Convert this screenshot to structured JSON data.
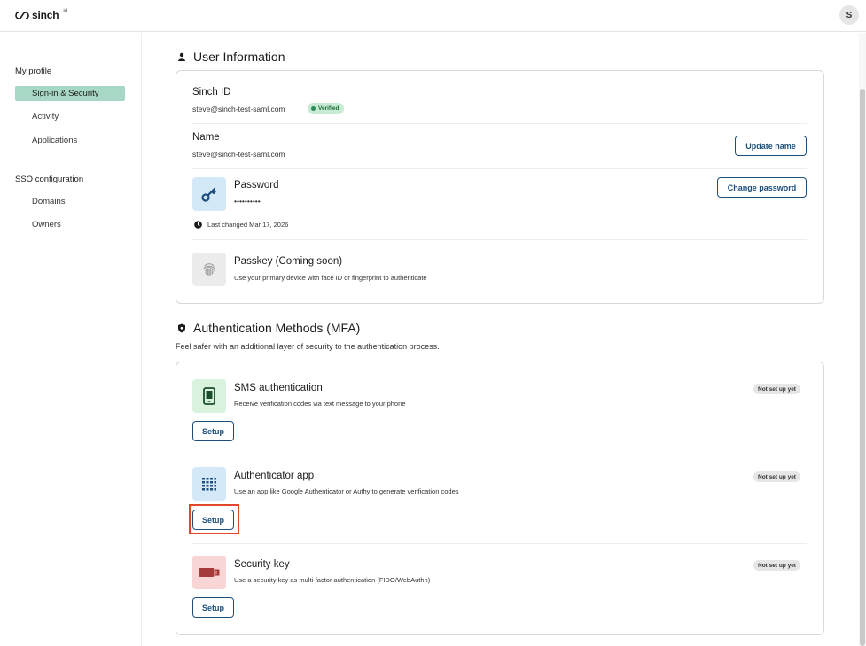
{
  "header": {
    "logo_text": "sinch",
    "logo_sup": "id",
    "avatar_initial": "S"
  },
  "sidebar": {
    "group1_title": "My profile",
    "group1_items": [
      "Sign-in & Security",
      "Activity",
      "Applications"
    ],
    "group2_title": "SSO configuration",
    "group2_items": [
      "Domains",
      "Owners"
    ]
  },
  "user_info": {
    "title": "User Information",
    "sinch_id_label": "Sinch ID",
    "sinch_id_value": "steve@sinch-test-saml.com",
    "verified_badge": "Verified",
    "name_label": "Name",
    "name_value": "steve@sinch-test-saml.com",
    "update_name_button": "Update name",
    "password_label": "Password",
    "password_value": "••••••••••",
    "change_password_button": "Change password",
    "last_changed": "Last changed Mar 17, 2026",
    "passkey_label": "Passkey (Coming soon)",
    "passkey_desc": "Use your primary device with face ID or fingerprint to authenticate"
  },
  "mfa": {
    "title": "Authentication Methods (MFA)",
    "subtitle": "Feel safer with an additional layer of security to the authentication process.",
    "methods": [
      {
        "name": "SMS authentication",
        "desc": "Receive verification codes via text message to your phone",
        "status": "Not set up yet",
        "button": "Setup",
        "icon": "phone-icon"
      },
      {
        "name": "Authenticator app",
        "desc": "Use an app like Google Authenticator or Authy to generate verification codes",
        "status": "Not set up yet",
        "button": "Setup",
        "icon": "grid-icon"
      },
      {
        "name": "Security key",
        "desc": "Use a security key as multi-factor authentication (FIDO/WebAuthn)",
        "status": "Not set up yet",
        "button": "Setup",
        "icon": "usb-key-icon"
      }
    ]
  },
  "colors": {
    "accent": "#1c4f7c",
    "sidebar_active": "#a6d8c5",
    "highlight": "#e0482c"
  }
}
